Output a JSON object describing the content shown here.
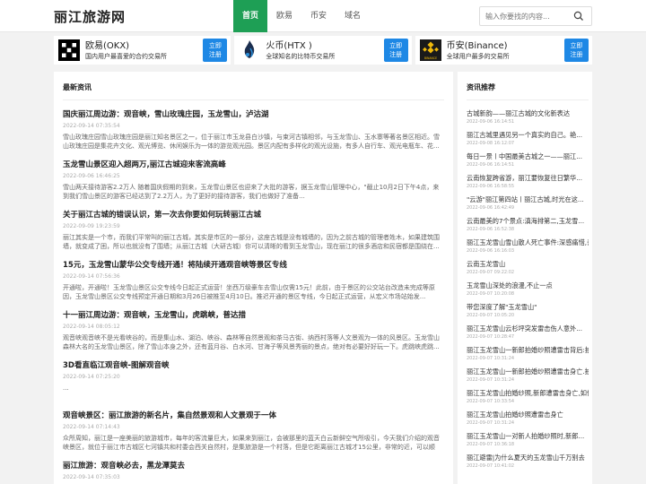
{
  "site": {
    "title": "丽江旅游网"
  },
  "nav": [
    {
      "label": "首页",
      "active": true
    },
    {
      "label": "欧易",
      "active": false
    },
    {
      "label": "币安",
      "active": false
    },
    {
      "label": "域名",
      "active": false
    }
  ],
  "search": {
    "placeholder": "输入你要找的内容..."
  },
  "exchanges": [
    {
      "name": "欧易(OKX)",
      "desc": "国内用户最喜爱的合约交易所",
      "button": "立即\n注册",
      "icon": "okx-logo"
    },
    {
      "name": "火币(HTX )",
      "desc": "全球知名的比特币交易所",
      "button": "立即\n注册",
      "icon": "htx-logo"
    },
    {
      "name": "币安(Binance)",
      "desc": "全球用户最多的交易所",
      "button": "立即\n注册",
      "icon": "binance-logo"
    }
  ],
  "latest": {
    "heading": "最新资讯",
    "articles": [
      {
        "title": "国庆丽江周边游：观音峡，雪山玫瑰庄园，玉龙雪山，泸沽湖",
        "date": "2022-09-14 07:35:54",
        "desc": "雪山玫瑰庄园雪山玫瑰庄园是丽江知名景区之一，位于丽江市玉龙县白沙镇，与束河古镇相邻，与玉龙雪山、玉水寨等著名景区相近。雪山玫瑰庄园是集花卉文化、观光博览、休闲娱乐为一体的游览观光园。景区内配有多样化的观光设施，有多人自行车、观光电瓶车、花..."
      },
      {
        "title": "玉龙雪山景区迎入超两万,丽江古城迎来客流高峰",
        "date": "2022-09-06 16:46:25",
        "desc": "雪山两天接待游客2.2万人 随着国庆假期的到来，玉龙雪山景区也迎来了大批的游客，据玉龙雪山管理中心，\"截止10月2日下午4点，来到我们雪山景区的游客已经达到了2.2万人，为了更好的接待游客，我们也做好了准备..."
      },
      {
        "title": "关于丽江古城的错误认识，第一次去你要如何玩转丽江古城",
        "date": "2022-09-09 19:23:59",
        "desc": "丽江其实是一个市，而我们平常叫的丽江古城，其实是市区的一部分，这座古城是没有城墙的，因为之前古城的管理者姓木，如果建筑围墙，就变成了困，所以也就没有了围墙；从丽江古城（大研古城）你可以清晰的看到玉龙雪山，现在丽江的很多酒店和民宿都是围绕在..."
      },
      {
        "title": "15元，玉龙雪山蒙华公交专线开通！将陆续开通观音峡等景区专线",
        "date": "2022-09-14 07:56:36",
        "desc": "开通啦，开通啦！玉龙雪山景区公交专线今日起正式运营！坐西万级豪车去雪山仅需15元！此前，由于景区的公交站台改造未完成等原因，玉龙雪山景区公交专线预定开通日期和3月26日被推至4月10日。推迟开通的景区专线，今日起正式运营，从宏义市场站始发..."
      },
      {
        "title": "十一丽江周边游：观音峡，玉龙雪山，虎跳峡，普达措",
        "date": "2022-09-14 08:05:12",
        "desc": "观音峡观音峡不是光看峡谷的，而是集山水、湖泊、峡谷、森林等自然景观和茶马古街、纳西村落等人文景观为一体的风景区。玉龙雪山森林大名的玉龙雪山景区，除了雪山本身之外，还有蓝月谷、白水河、甘海子等风景秀丽的景点，绝对有必要好好玩一下。虎跳峡虎跳..."
      },
      {
        "title": "3D看直临江观音峡-图解观音峡",
        "date": "2022-09-14 07:25:20",
        "desc": "..."
      },
      {
        "title": "观音峡景区：丽江旅游的新名片，集自然景观和人文景观于一体",
        "date": "2022-09-14 07:14:43",
        "desc": "众所周知，丽江是一座美丽的旅游城市，每年的客流量巨大，如果来到丽江，会被那里的蓝天白云新鲜空气所吸引，今天我们介绍的观音峡景区，就位于丽江市古城区七河镇共和村委会西关自然村，是集旅游是一个村落，但是它距离丽江古城才15公里，非常的近，可以顺便..."
      },
      {
        "title": "丽江旅游：观音峡必去，黑龙潭莫去",
        "date": "2022-09-14 07:35:03",
        "desc": ""
      }
    ]
  },
  "recommend": {
    "heading": "资讯推荐",
    "items": [
      {
        "title": "古城新韵——丽江古城的文化新表达",
        "date": "2022-09-06 16:14:51"
      },
      {
        "title": "丽江古城里遇见另一个真实的自己。艳...",
        "date": "2022-09-08 16:12:07"
      },
      {
        "title": "每日一景丨中国最美古城之一——丽江...",
        "date": "2022-09-06 16:14:51"
      },
      {
        "title": "云南恢复跨省游，丽江要恢复往日繁华...",
        "date": "2022-09-06 16:58:55"
      },
      {
        "title": "\"云游\"丽江第四站丨丽江古城,时光在这...",
        "date": "2022-09-06 16:42:49"
      },
      {
        "title": "云南最美的7个景点:滇海排第二,玉龙雪...",
        "date": "2022-09-06 16:52:38"
      },
      {
        "title": "丽江玉龙雪山雪山散人死亡事件:深感痛惜,善...",
        "date": "2022-09-06 16:16:03"
      },
      {
        "title": "云南玉龙雪山",
        "date": "2022-09-07 09:22:02"
      },
      {
        "title": "玉龙雪山深处的浪漫,不止一点",
        "date": "2022-09-07 10:20:08"
      },
      {
        "title": "带您深度了解\"玉龙雪山\"",
        "date": "2022-09-07 10:05:20"
      },
      {
        "title": "丽江玉龙雪山云杉坪突发雷击伤人意外...",
        "date": "2022-09-07 10:28:47"
      },
      {
        "title": "丽江玉龙雪山一新郎拍婚纱照遭雷击背后:拍...",
        "date": "2022-09-07 10:31:24"
      },
      {
        "title": "丽江玉龙雪山一新郎拍婚纱照遭雷击身亡.拍...",
        "date": "2022-09-07 10:31:24"
      },
      {
        "title": "丽江玉龙雪山拍婚纱照,新郎遭雷击身亡,如何...",
        "date": "2022-09-07 10:33:54"
      },
      {
        "title": "丽江玉龙雪山拍婚纱照遭雷击身亡",
        "date": "2022-09-07 10:31:24"
      },
      {
        "title": "丽江玉龙雪山一对新人拍婚纱照时,新郎...",
        "date": "2022-09-07 10:36:18"
      },
      {
        "title": "丽江避雷|为什么夏天的玉龙雪山千万别去",
        "date": "2022-09-07 10:41:02"
      }
    ]
  },
  "colors": {
    "accent": "#1e9f55",
    "button": "#1e88e5"
  }
}
